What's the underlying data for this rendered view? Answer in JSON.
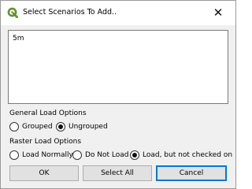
{
  "window": {
    "title": "Select Scenarios To Add..",
    "close_glyph": "✕",
    "app_icon": "qgis-logo-icon",
    "accent_color": "#589632"
  },
  "scenario_list": {
    "items": [
      "5m"
    ]
  },
  "general_load_options": {
    "label": "General Load Options",
    "options": [
      {
        "label": "Grouped",
        "checked": false
      },
      {
        "label": "Ungrouped",
        "checked": true
      }
    ]
  },
  "raster_load_options": {
    "label": "Raster Load Options",
    "options": [
      {
        "label": "Load Normally",
        "checked": false
      },
      {
        "label": "Do Not Load",
        "checked": false
      },
      {
        "label": "Load, but not checked on",
        "checked": true
      }
    ]
  },
  "buttons": {
    "ok": "OK",
    "select_all": "Select All",
    "cancel": "Cancel"
  }
}
